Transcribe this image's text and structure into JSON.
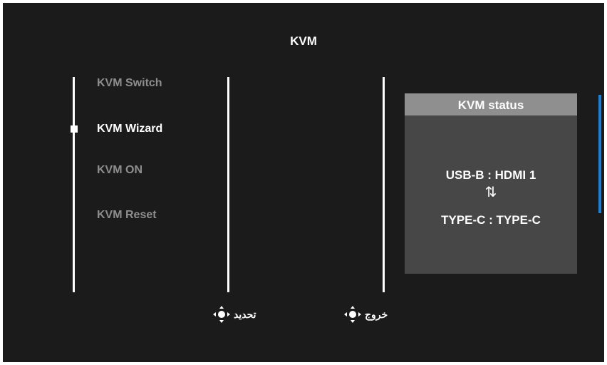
{
  "menu": {
    "title": "KVM",
    "items": [
      {
        "label": "KVM Switch",
        "selected": false
      },
      {
        "label": "KVM Wizard",
        "selected": true
      },
      {
        "label": "KVM ON",
        "selected": false
      },
      {
        "label": "KVM Reset",
        "selected": false
      }
    ]
  },
  "status": {
    "header": "KVM status",
    "line1": "USB-B : HDMI 1",
    "arrows": "⇅",
    "line2": "TYPE-C : TYPE-C"
  },
  "hints": {
    "select_label": "تحديد",
    "exit_label": "خروج",
    "icon": "joystick-icon"
  },
  "colors": {
    "background": "#1b1b1b",
    "accent": "#1f7fd0",
    "inactive_text": "#8e8e8e",
    "panel": "#474747",
    "panel_header": "#8f8f8f"
  }
}
